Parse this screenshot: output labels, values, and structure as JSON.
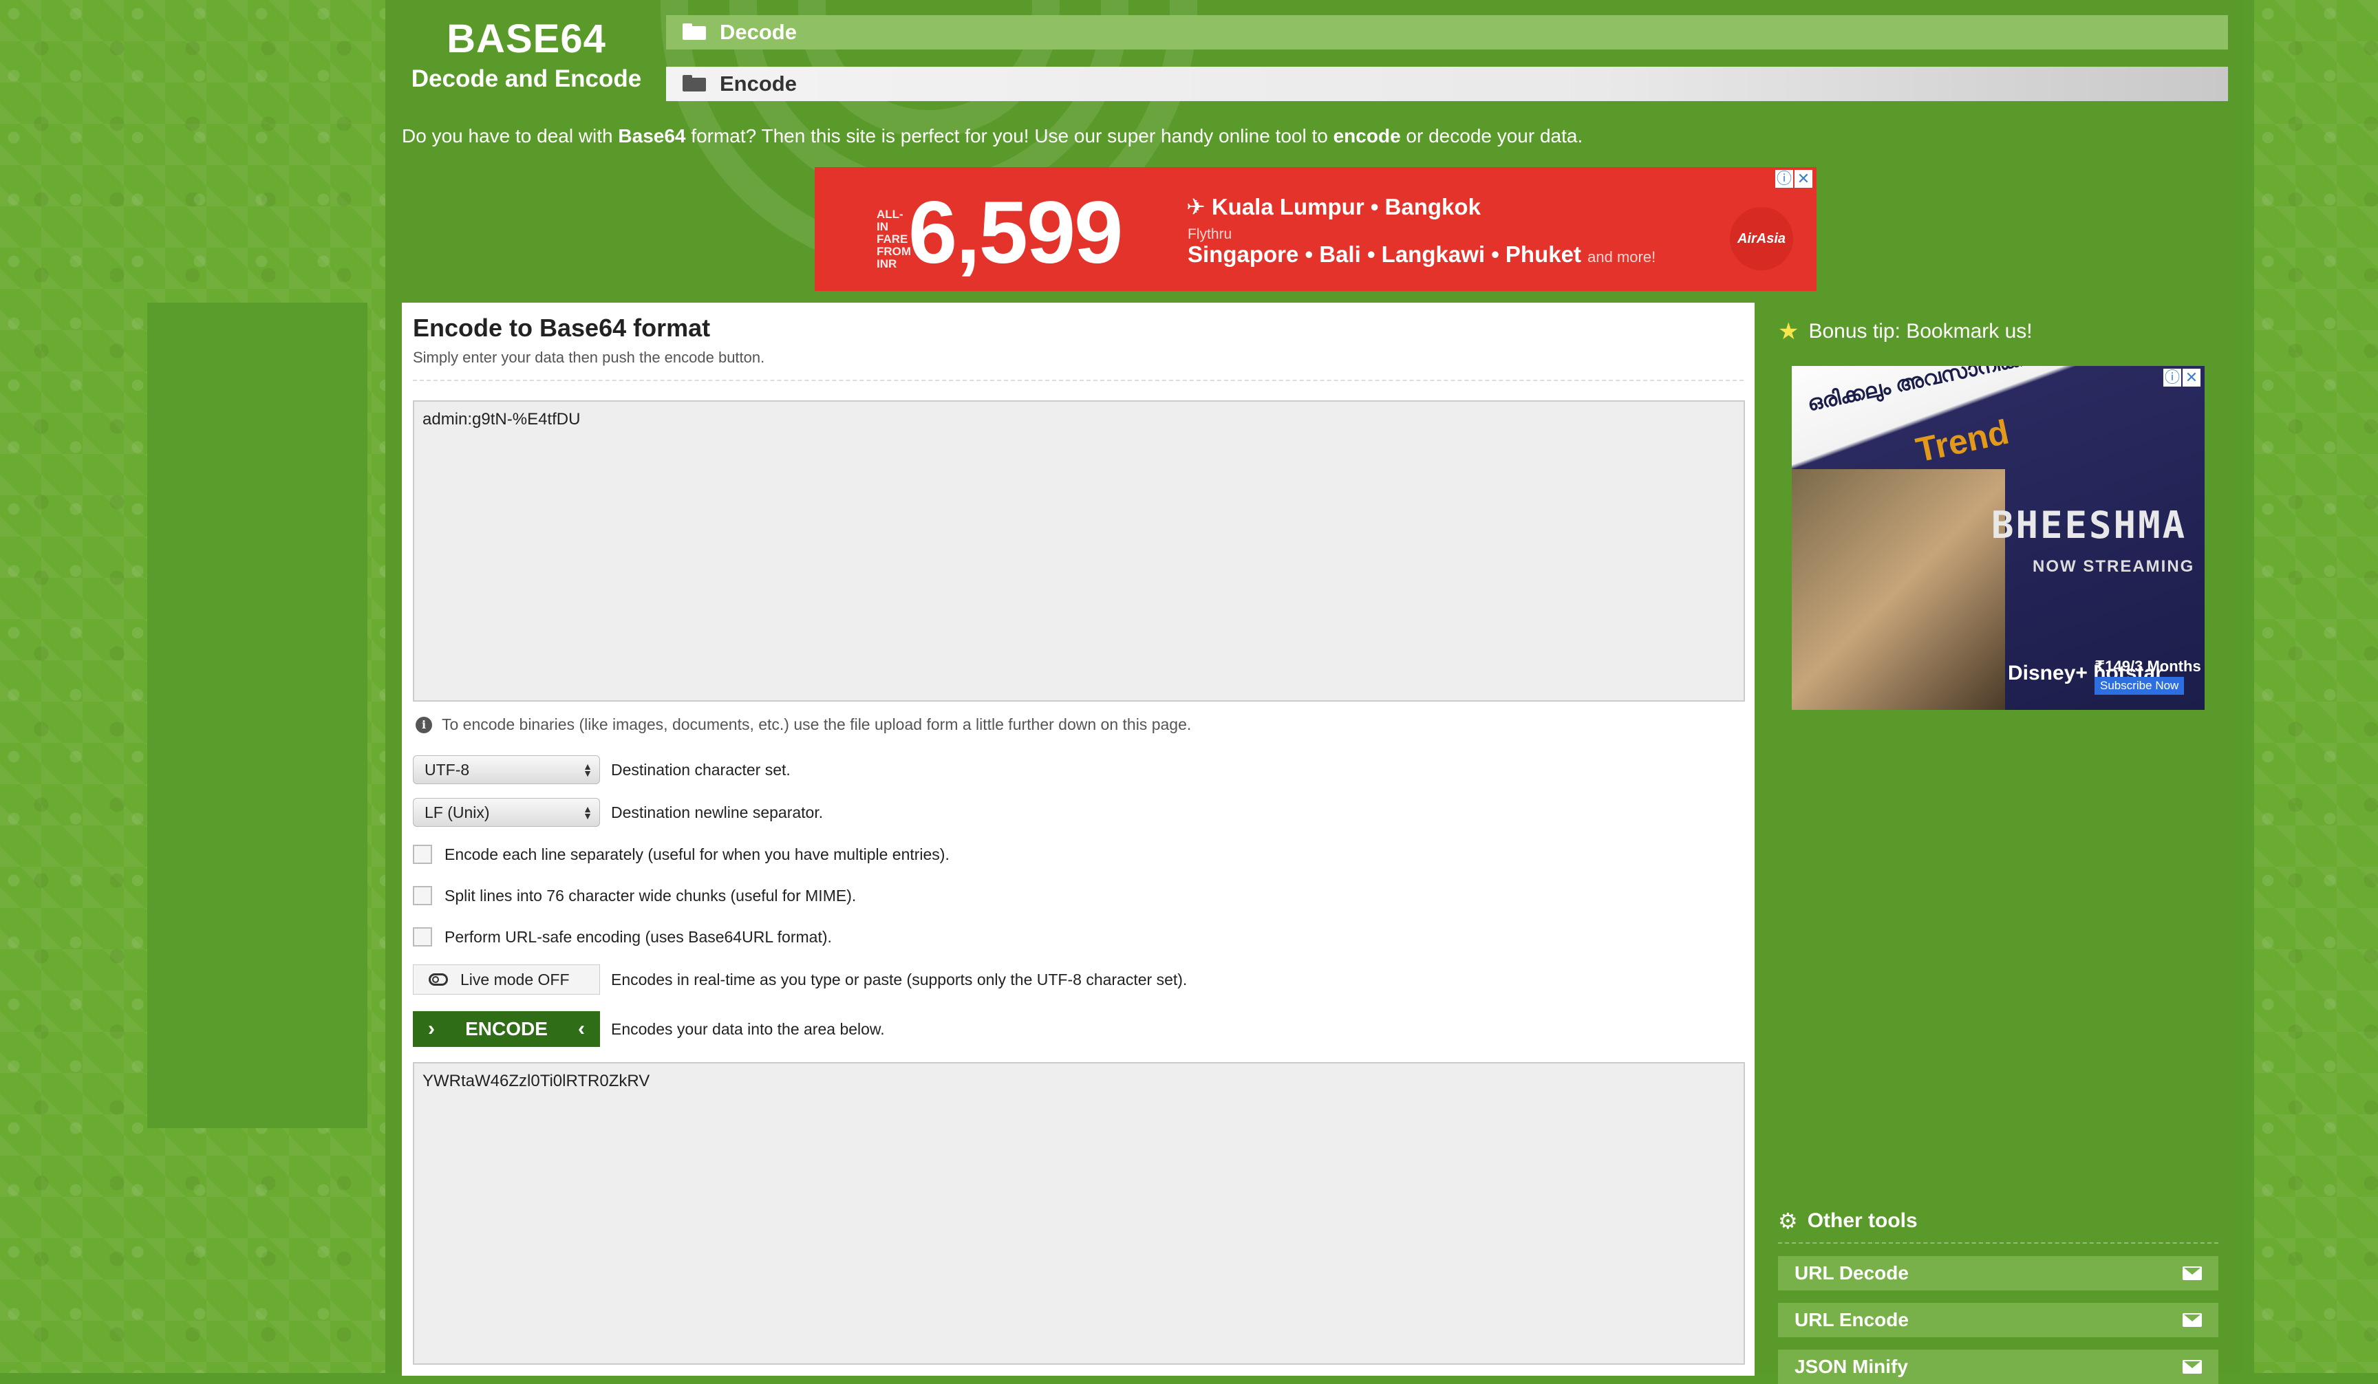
{
  "logo": {
    "title": "BASE64",
    "subtitle": "Decode and Encode"
  },
  "nav": {
    "decode_label": "Decode",
    "encode_label": "Encode"
  },
  "intro": {
    "part1": "Do you have to deal with ",
    "bold1": "Base64",
    "part2": " format? Then this site is perfect for you! Use our super handy online tool to ",
    "bold2": "encode",
    "part3": " or decode your data."
  },
  "ad_top": {
    "fare_label": "ALL-IN FARE FROM INR",
    "price": "6,599",
    "route1": "✈ Kuala Lumpur • Bangkok",
    "flythru": "Flythru",
    "route2": "Singapore • Bali • Langkawi • Phuket",
    "route2_more": "and more!",
    "brand": "AirAsia"
  },
  "panel": {
    "title": "Encode to Base64 format",
    "subtitle": "Simply enter your data then push the encode button.",
    "input_value": "admin:g9tN-%E4tfDU",
    "info_text": "To encode binaries (like images, documents, etc.) use the file upload form a little further down on this page.",
    "charset": {
      "value": "UTF-8",
      "label": "Destination character set."
    },
    "newline": {
      "value": "LF (Unix)",
      "label": "Destination newline separator."
    },
    "opt_each_line": "Encode each line separately (useful for when you have multiple entries).",
    "opt_split": "Split lines into 76 character wide chunks (useful for MIME).",
    "opt_urlsafe": "Perform URL-safe encoding (uses Base64URL format).",
    "live_mode": {
      "label": "Live mode OFF",
      "description": "Encodes in real-time as you type or paste (supports only the UTF-8 character set)."
    },
    "encode_button": {
      "label": "ENCODE",
      "description": "Encodes your data into the area below."
    },
    "output_value": "YWRtaW46Zzl0Ti0lRTR0ZkRV"
  },
  "sidebar": {
    "bonus_tip": "Bonus tip: Bookmark us!",
    "ad": {
      "line1": "ഒരിക്കലും അവസാനിക്കാത്ത",
      "trend": "Trend",
      "title": "BHEESHMA",
      "now": "NOW STREAMING",
      "brand": "Disney+ hotstar",
      "price": "₹149/3 Months",
      "subscribe": "Subscribe Now"
    },
    "other_tools_title": "Other tools",
    "tools": [
      "URL Decode",
      "URL Encode",
      "JSON Minify"
    ]
  },
  "colors": {
    "background": "#5a9c2c",
    "encode_button": "#2f6e17",
    "tool_item": "#78b14a",
    "ad_red": "#e4332a"
  }
}
